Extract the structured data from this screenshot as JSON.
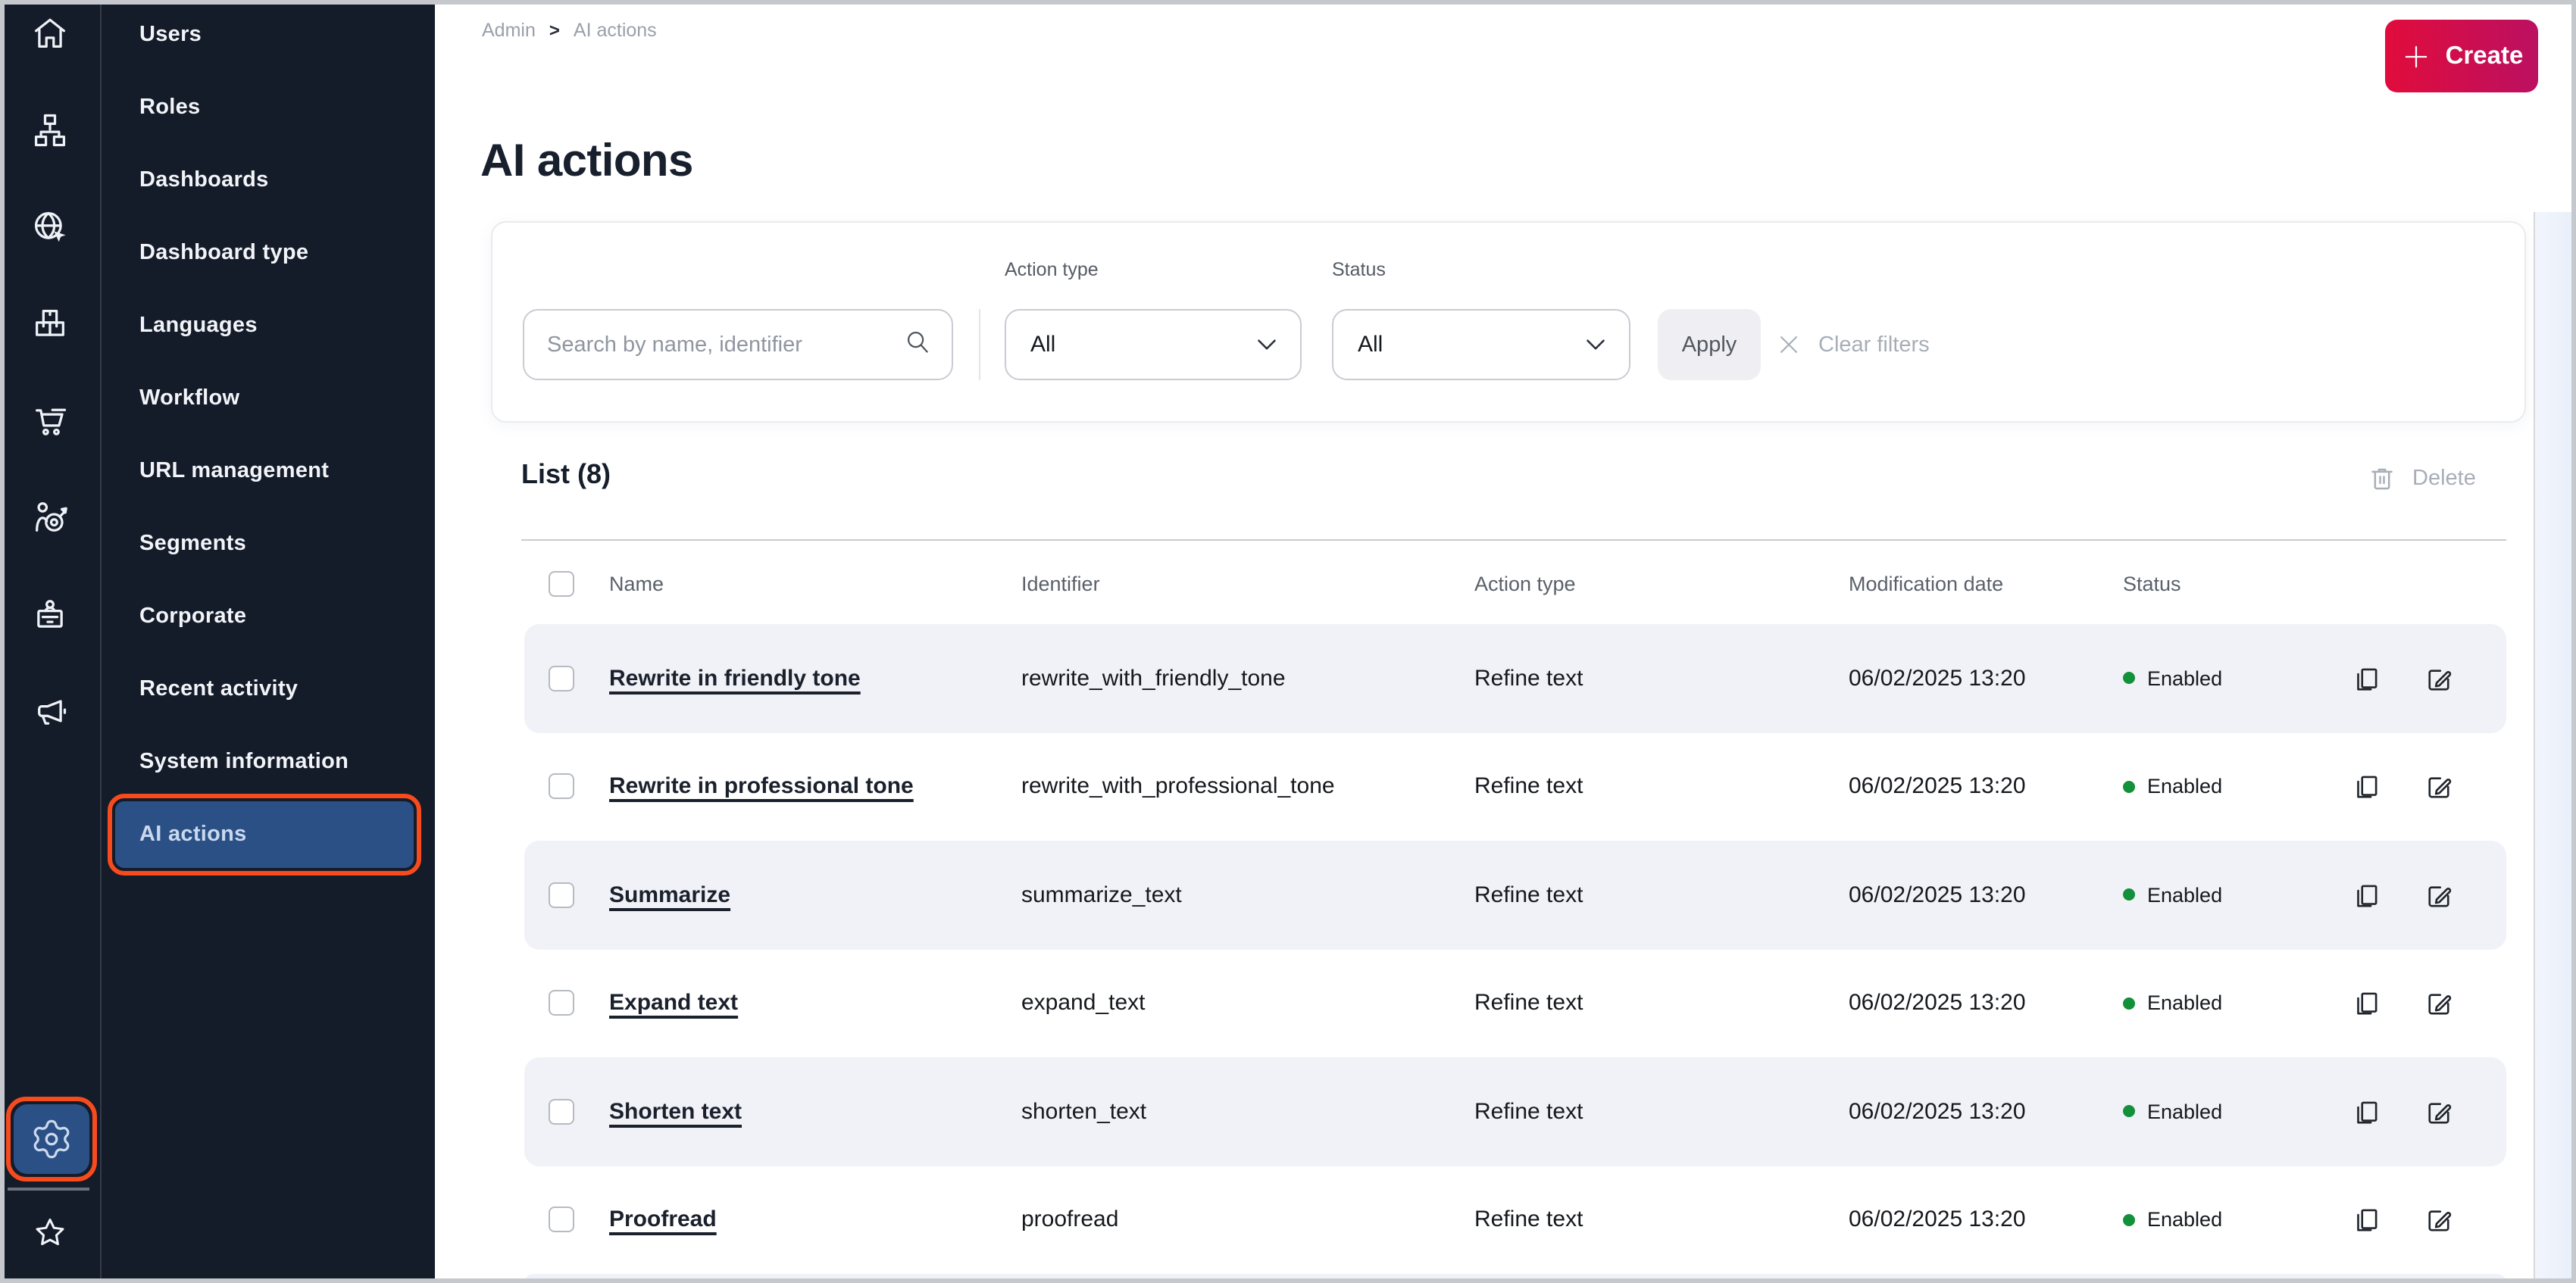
{
  "sidebar": {
    "bg_color": "#141b29",
    "selected_bg": "#2b5085",
    "selected_outline": "#f74b1e",
    "rail": {
      "icons": [
        {
          "name": "home"
        },
        {
          "name": "sitemap"
        },
        {
          "name": "globe-pointer"
        },
        {
          "name": "packages"
        },
        {
          "name": "shopping-cart"
        },
        {
          "name": "audience-target"
        },
        {
          "name": "badge"
        },
        {
          "name": "megaphone"
        }
      ],
      "settings": {
        "name": "settings-gear",
        "selected": true
      },
      "favorites": {
        "name": "favorites-star"
      }
    },
    "menu": {
      "items": [
        {
          "label": "Users"
        },
        {
          "label": "Roles"
        },
        {
          "label": "Dashboards"
        },
        {
          "label": "Dashboard type"
        },
        {
          "label": "Languages"
        },
        {
          "label": "Workflow"
        },
        {
          "label": "URL management"
        },
        {
          "label": "Segments"
        },
        {
          "label": "Corporate"
        },
        {
          "label": "Recent activity"
        },
        {
          "label": "System information"
        },
        {
          "label": "AI actions",
          "selected": true
        }
      ]
    }
  },
  "header": {
    "breadcrumb": {
      "root": "Admin",
      "separator": ">",
      "current": "AI actions"
    },
    "title": "AI actions",
    "create_button": {
      "label": "Create",
      "icon": "plus",
      "gradient_start": "#e10c3c",
      "gradient_end": "#bb1061"
    }
  },
  "filters": {
    "search": {
      "placeholder": "Search by name, identifier",
      "value": "",
      "icon": "search"
    },
    "action_type": {
      "label": "Action type",
      "value": "All"
    },
    "status": {
      "label": "Status",
      "value": "All"
    },
    "apply": {
      "label": "Apply"
    },
    "clear": {
      "label": "Clear filters",
      "icon": "x"
    }
  },
  "list": {
    "title": "List (8)",
    "count": 8,
    "delete": {
      "label": "Delete",
      "icon": "trash",
      "disabled": true
    },
    "columns": [
      "Name",
      "Identifier",
      "Action type",
      "Modification date",
      "Status"
    ],
    "status_dot_color": "#12903a",
    "row_actions": [
      {
        "name": "copy"
      },
      {
        "name": "edit"
      }
    ],
    "rows": [
      {
        "name": "Rewrite in friendly tone",
        "identifier": "rewrite_with_friendly_tone",
        "action_type": "Refine text",
        "modification_date": "06/02/2025 13:20",
        "status": "Enabled"
      },
      {
        "name": "Rewrite in professional tone",
        "identifier": "rewrite_with_professional_tone",
        "action_type": "Refine text",
        "modification_date": "06/02/2025 13:20",
        "status": "Enabled"
      },
      {
        "name": "Summarize",
        "identifier": "summarize_text",
        "action_type": "Refine text",
        "modification_date": "06/02/2025 13:20",
        "status": "Enabled"
      },
      {
        "name": "Expand text",
        "identifier": "expand_text",
        "action_type": "Refine text",
        "modification_date": "06/02/2025 13:20",
        "status": "Enabled"
      },
      {
        "name": "Shorten text",
        "identifier": "shorten_text",
        "action_type": "Refine text",
        "modification_date": "06/02/2025 13:20",
        "status": "Enabled"
      },
      {
        "name": "Proofread",
        "identifier": "proofread",
        "action_type": "Refine text",
        "modification_date": "06/02/2025 13:20",
        "status": "Enabled"
      }
    ]
  }
}
